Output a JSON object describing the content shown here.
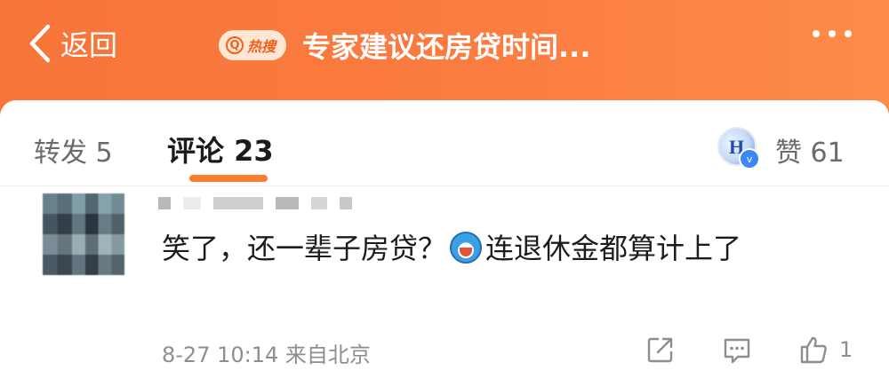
{
  "header": {
    "back_label": "返回",
    "hot_badge": "热搜",
    "title": "专家建议还房贷时间..."
  },
  "tabs": {
    "repost": "转发 5",
    "comments": "评论 23",
    "likes": "赞 61"
  },
  "comment": {
    "text": "笑了，还一辈子房贷？",
    "emoji": "doraemon-emoji",
    "text_after": "连退休金都算计上了",
    "time": "8-27 10:14",
    "source": "来自北京",
    "like_count": "1"
  },
  "colors": {
    "header_orange": "#f7753a",
    "accent": "#fb7d2c"
  }
}
